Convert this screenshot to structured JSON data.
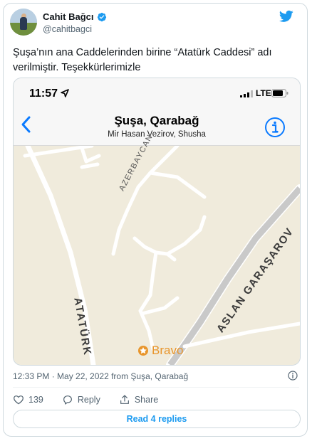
{
  "tweet": {
    "author_name": "Cahit Bağcı",
    "author_handle": "@cahitbagci",
    "text": "Şuşa’nın ana Caddelerinden birine “Atatürk Caddesi” adı verilmiştir. Teşekkürlerimizle",
    "timestamp": "12:33 PM · May 22, 2022 from Şuşa, Qarabağ",
    "like_count": "139",
    "reply_label": "Reply",
    "share_label": "Share",
    "read_replies_label": "Read 4 replies"
  },
  "screenshot": {
    "status_time": "11:57",
    "network": "LTE",
    "nav_title": "Şuşa, Qarabağ",
    "nav_subtitle": "Mir Hasan Vezirov, Shusha",
    "map_labels": {
      "azerbaycan": "AZERBAYCAN",
      "ataturk": "ATATÜRK",
      "aslan": "ASLAN GARAŞAROV",
      "bravo": "Bravo"
    }
  },
  "colors": {
    "accent": "#1d9bf0",
    "ios_blue": "#0a7aff",
    "map_bg": "#f0ebdc",
    "road": "#ffffff",
    "highway": "#c7c7c7",
    "poi": "#e8952b"
  },
  "icons": [
    "verified-icon",
    "twitter-bird-icon",
    "location-arrow-icon",
    "signal-icon",
    "battery-icon",
    "back-chevron-icon",
    "info-icon",
    "heart-icon",
    "reply-icon",
    "share-icon",
    "poi-icon"
  ]
}
